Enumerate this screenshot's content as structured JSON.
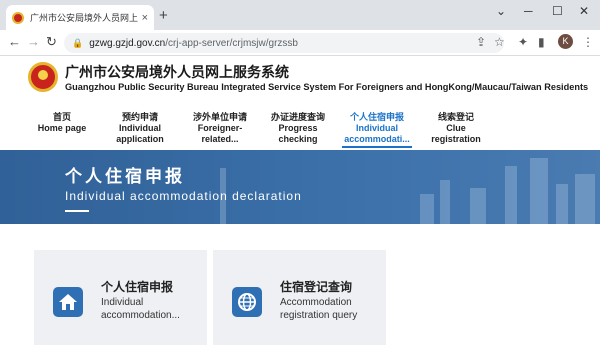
{
  "browser": {
    "tab_title": "广州市公安局境外人员网上服务",
    "tab_close": "×",
    "new_tab": "+",
    "url_host": "gzwg.gzjd.gov.cn",
    "url_path": "/crj-app-server/crjmsjw/grzssb",
    "profile_initial": "K"
  },
  "site": {
    "title_cn": "广州市公安局境外人员网上服务系统",
    "title_en": "Guangzhou Public Security Bureau Integrated Service System For Foreigners and HongKong/Maucau/Taiwan Residents"
  },
  "menu": [
    {
      "zh": "首页",
      "en": "Home page",
      "en2": ""
    },
    {
      "zh": "预约申请",
      "en": "Individual",
      "en2": "application"
    },
    {
      "zh": "涉外单位申请",
      "en": "Foreigner-",
      "en2": "related..."
    },
    {
      "zh": "办证进度查询",
      "en": "Progress",
      "en2": "checking"
    },
    {
      "zh": "个人住宿申报",
      "en": "Individual",
      "en2": "accommodati..."
    },
    {
      "zh": "线索登记",
      "en": "Clue",
      "en2": "registration"
    }
  ],
  "banner": {
    "title": "个人住宿申报",
    "subtitle": "Individual accommodation declaration"
  },
  "cards": [
    {
      "title": "个人住宿申报",
      "desc_line1": "Individual",
      "desc_line2": "accommodation..."
    },
    {
      "title": "住宿登记查询",
      "desc_line1": "Accommodation",
      "desc_line2": "registration query"
    }
  ],
  "colors": {
    "accent": "#1a73c8",
    "banner": "#3a6fa8",
    "card_bg": "#eef0f3",
    "icon_bg": "#2f6fb3"
  }
}
